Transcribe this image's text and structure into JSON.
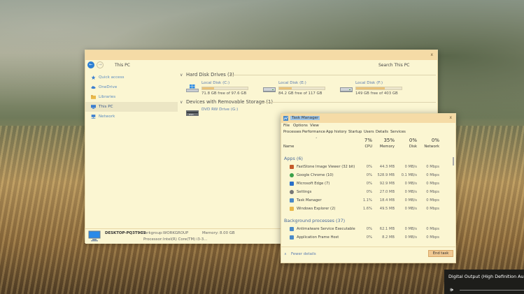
{
  "explorer": {
    "address": "This PC",
    "search_placeholder": "Search This PC",
    "close_glyph": "x",
    "sidebar": [
      {
        "label": "Quick access",
        "icon": "star-icon",
        "color": "#3b7ed0"
      },
      {
        "label": "OneDrive",
        "icon": "cloud-icon",
        "color": "#3b7ed0"
      },
      {
        "label": "Libraries",
        "icon": "folder-icon",
        "color": "#e8b84a"
      },
      {
        "label": "This PC",
        "icon": "monitor-icon",
        "color": "#3b7ed0",
        "active": true
      },
      {
        "label": "Network",
        "icon": "network-icon",
        "color": "#3b7ed0"
      }
    ],
    "hard_disk_group": "Hard Disk Drives (3)",
    "drives": [
      {
        "name": "Local Disk (C:)",
        "free": "71.8 GB free of 97.6 GB",
        "used_fraction": 0.26,
        "icon": "windows-drive-icon"
      },
      {
        "name": "Local Disk (E:)",
        "free": "84.2 GB free of 117 GB",
        "used_fraction": 0.28,
        "icon": "hdd-icon"
      },
      {
        "name": "Local Disk (F:)",
        "free": "149 GB free of 403 GB",
        "used_fraction": 0.63,
        "icon": "hdd-icon"
      }
    ],
    "removable_group": "Devices with Removable Storage (1)",
    "dvd": {
      "name": "DVD RW Drive (G:)",
      "icon": "dvd-drive-icon"
    },
    "status": {
      "computer_name": "DESKTOP-PQ3T9G2",
      "workgroup_label": "Workgroup:",
      "workgroup": "WORKGROUP",
      "memory_label": "Memory:",
      "memory": "8.00 GB",
      "processor_label": "Processor:",
      "processor": "Intel(R) Core(TM) i3-3..."
    }
  },
  "taskman": {
    "title": "Task Manager",
    "close_glyph": "x",
    "menu": [
      "File",
      "Options",
      "View"
    ],
    "tabs": [
      "Processes",
      "Performance",
      "App history",
      "Startup",
      "Users",
      "Details",
      "Services"
    ],
    "header": {
      "name": "Name",
      "cpu_pct": "7%",
      "cpu": "CPU",
      "mem_pct": "35%",
      "mem": "Memory",
      "disk_pct": "0%",
      "disk": "Disk",
      "net_pct": "0%",
      "net": "Network"
    },
    "apps_section": "Apps (6)",
    "apps": [
      {
        "name": "FastStone Image Viewer (32 bit)",
        "cpu": "0%",
        "mem": "44.3 MB",
        "disk": "0 MB/s",
        "net": "0 Mbps",
        "icon": "image-viewer-icon",
        "color": "#c45a2a"
      },
      {
        "name": "Google Chrome (10)",
        "cpu": "0%",
        "mem": "528.9 MB",
        "disk": "0.1 MB/s",
        "net": "0 Mbps",
        "icon": "chrome-icon",
        "color": "#3aa04a"
      },
      {
        "name": "Microsoft Edge (7)",
        "cpu": "0%",
        "mem": "92.9 MB",
        "disk": "0 MB/s",
        "net": "0 Mbps",
        "icon": "edge-icon",
        "color": "#2a6fc8"
      },
      {
        "name": "Settings",
        "cpu": "0%",
        "mem": "27.0 MB",
        "disk": "0 MB/s",
        "net": "0 Mbps",
        "icon": "gear-icon",
        "color": "#777777"
      },
      {
        "name": "Task Manager",
        "cpu": "1.1%",
        "mem": "18.4 MB",
        "disk": "0 MB/s",
        "net": "0 Mbps",
        "icon": "task-manager-icon",
        "color": "#4a8ac8"
      },
      {
        "name": "Windows Explorer (2)",
        "cpu": "1.6%",
        "mem": "49.5 MB",
        "disk": "0 MB/s",
        "net": "0 Mbps",
        "icon": "folder-icon",
        "color": "#e8b84a"
      }
    ],
    "bg_section": "Background processes (37)",
    "bg": [
      {
        "name": "Antimalware Service Executable",
        "cpu": "0%",
        "mem": "62.1 MB",
        "disk": "0 MB/s",
        "net": "0 Mbps",
        "icon": "shield-icon",
        "color": "#4a8ac8"
      },
      {
        "name": "Application Frame Host",
        "cpu": "0%",
        "mem": "8.2 MB",
        "disk": "0 MB/s",
        "net": "0 Mbps",
        "icon": "app-frame-icon",
        "color": "#4a8ac8"
      }
    ],
    "fewer_details": "Fewer details",
    "end_task": "End task"
  },
  "audio": {
    "device": "Digital Output (High Definition Audio"
  }
}
